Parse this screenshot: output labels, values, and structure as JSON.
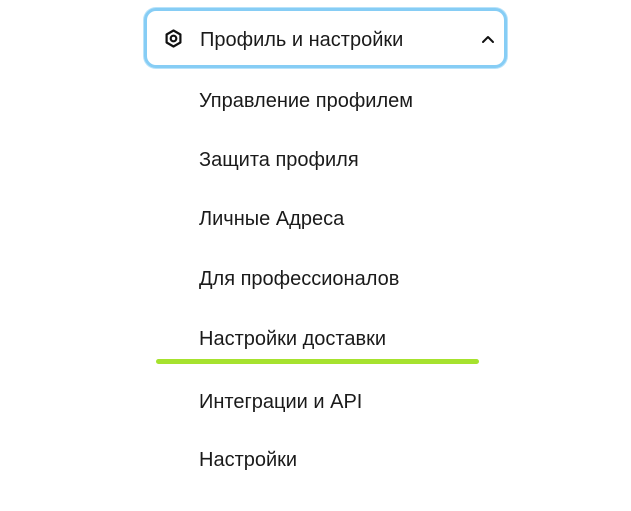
{
  "menu": {
    "header": {
      "label": "Профиль и настройки",
      "icon": "gear-hex-icon",
      "chevron": "chevron-up-icon",
      "expanded": true,
      "focus_border_color": "#86cdf5"
    },
    "items": [
      {
        "label": "Управление профилем"
      },
      {
        "label": "Защита профиля"
      },
      {
        "label": "Личные Адреса"
      },
      {
        "label": "Для профессионалов"
      },
      {
        "label": "Настройки доставки",
        "active": true
      },
      {
        "label": "Интеграции и API"
      },
      {
        "label": "Настройки"
      }
    ],
    "active_indicator_color": "#a6e22e"
  }
}
